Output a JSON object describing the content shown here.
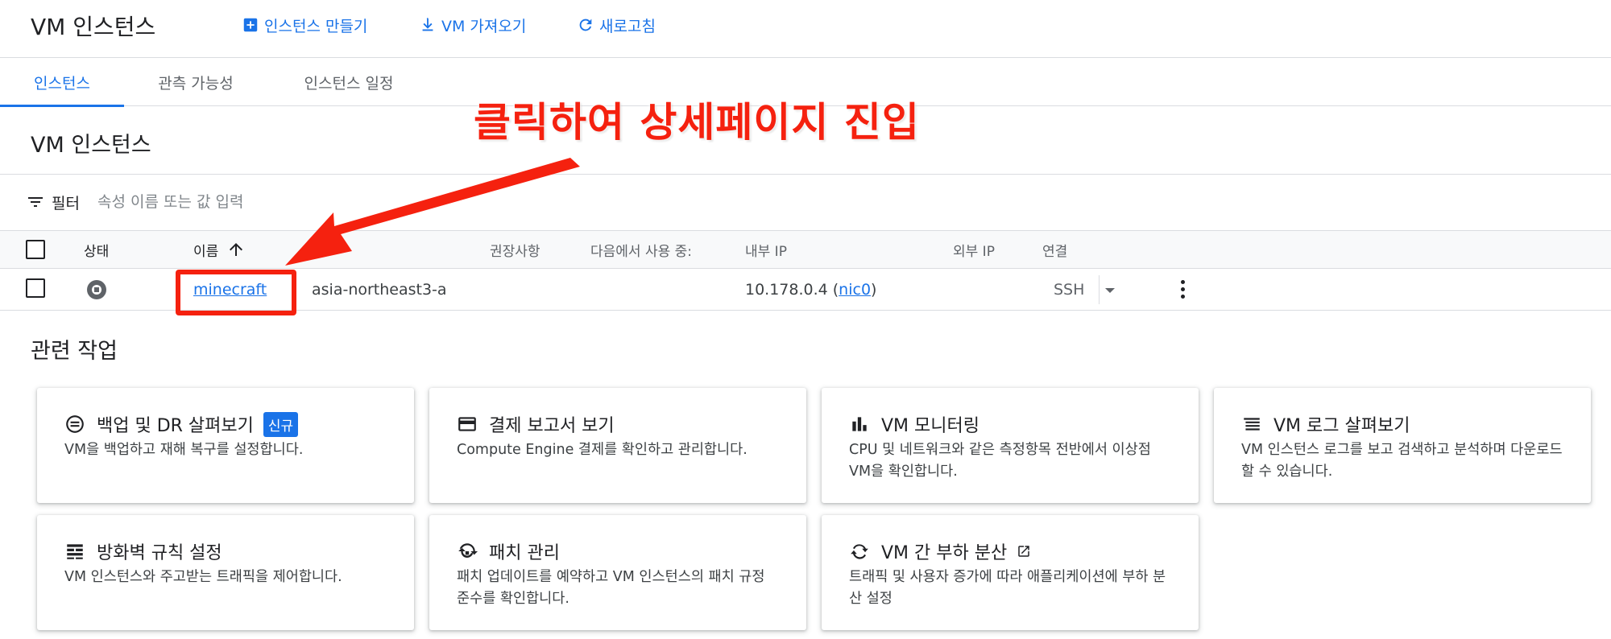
{
  "header": {
    "title": "VM 인스턴스",
    "actions": [
      {
        "label": "인스턴스 만들기",
        "icon": "add-box-icon"
      },
      {
        "label": "VM 가져오기",
        "icon": "download-icon"
      },
      {
        "label": "새로고침",
        "icon": "refresh-icon"
      }
    ]
  },
  "tabs": [
    {
      "label": "인스턴스",
      "active": true
    },
    {
      "label": "관측 가능성",
      "active": false
    },
    {
      "label": "인스턴스 일정",
      "active": false
    }
  ],
  "section_title": "VM 인스턴스",
  "filter": {
    "label": "필터",
    "placeholder": "속성 이름 또는 값 입력"
  },
  "table": {
    "columns": [
      "상태",
      "이름",
      "권장사항",
      "다음에서 사용 중:",
      "내부 IP",
      "외부 IP",
      "연결"
    ],
    "sort_indicator": "ascending",
    "rows": [
      {
        "status": "stopped",
        "name": "minecraft",
        "zone": "asia-northeast3-a",
        "internal_ip": "10.178.0.4",
        "nic_paren_open": "(",
        "nic": "nic0",
        "nic_paren_close": ")",
        "connect": "SSH"
      }
    ]
  },
  "annotation": {
    "text": "클릭하여 상세페이지 진입",
    "color": "#f5210f"
  },
  "related": {
    "title": "관련 작업",
    "cards": [
      {
        "title": "백업 및 DR 살펴보기",
        "badge": "신규",
        "desc": "VM을 백업하고 재해 복구를 설정합니다.",
        "icon": "backup-icon"
      },
      {
        "title": "결제 보고서 보기",
        "desc": "Compute Engine 결제를 확인하고 관리합니다.",
        "icon": "credit-card-icon"
      },
      {
        "title": "VM 모니터링",
        "desc": "CPU 및 네트워크와 같은 측정항목 전반에서 이상점 VM을 확인합니다.",
        "icon": "bar-chart-icon"
      },
      {
        "title": "VM 로그 살펴보기",
        "desc": "VM 인스턴스 로그를 보고 검색하고 분석하며 다운로드할 수 있습니다.",
        "icon": "logs-icon"
      },
      {
        "title": "방화벽 규칙 설정",
        "desc": "VM 인스턴스와 주고받는 트래픽을 제어합니다.",
        "icon": "firewall-icon"
      },
      {
        "title": "패치 관리",
        "desc": "패치 업데이트를 예약하고 VM 인스턴스의 패치 규정 준수를 확인합니다.",
        "icon": "patch-icon"
      },
      {
        "title": "VM 간 부하 분산",
        "desc": "트래픽 및 사용자 증가에 따라 애플리케이션에 부하 분산 설정",
        "icon": "load-balance-icon",
        "external": true
      }
    ]
  },
  "colors": {
    "accent": "#1a73e8",
    "annotation": "#f5210f"
  }
}
